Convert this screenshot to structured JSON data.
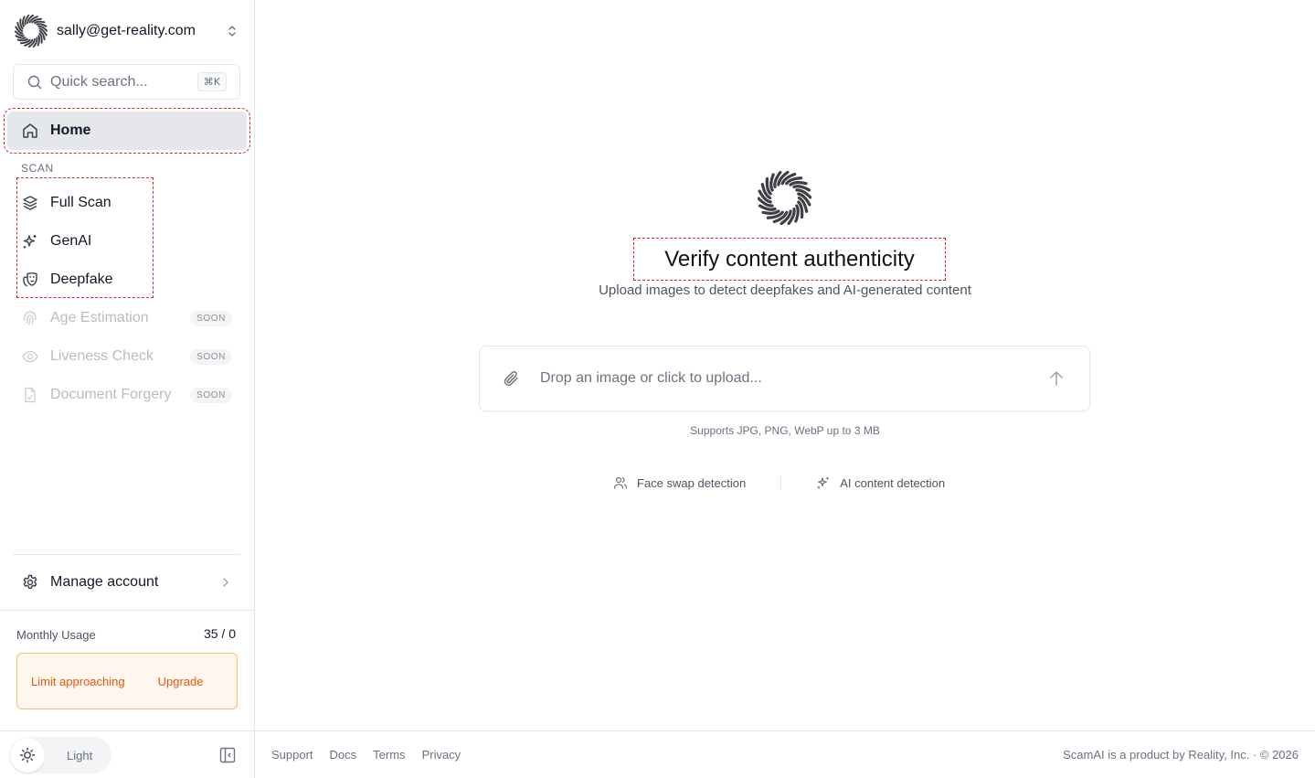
{
  "sidebar": {
    "account_email": "sally@get-reality.com",
    "search": {
      "placeholder": "Quick search...",
      "shortcut": "⌘K"
    },
    "home_label": "Home",
    "section_scan": "SCAN",
    "scan_items": [
      {
        "label": "Full Scan",
        "icon": "layers-icon"
      },
      {
        "label": "GenAI",
        "icon": "sparkles-icon"
      },
      {
        "label": "Deepfake",
        "icon": "theater-mask-icon"
      }
    ],
    "soon_items": [
      {
        "label": "Age Estimation",
        "badge": "SOON",
        "icon": "fingerprint-icon"
      },
      {
        "label": "Liveness Check",
        "badge": "SOON",
        "icon": "eye-icon"
      },
      {
        "label": "Document Forgery",
        "badge": "SOON",
        "icon": "file-icon"
      }
    ],
    "manage_account_label": "Manage account",
    "usage": {
      "label": "Monthly Usage",
      "value": "35 / 0"
    },
    "limit": {
      "message": "Limit approaching",
      "upgrade_label": "Upgrade"
    },
    "theme_label": "Light"
  },
  "main": {
    "title": "Verify content authenticity",
    "subtitle": "Upload images to detect deepfakes and AI-generated content",
    "upload_placeholder": "Drop an image or click to upload...",
    "supports_text": "Supports JPG, PNG, WebP up to 3 MB",
    "features": [
      {
        "label": "Face swap detection",
        "icon": "users-icon"
      },
      {
        "label": "AI content detection",
        "icon": "sparkles-icon"
      }
    ]
  },
  "footer": {
    "links": [
      "Support",
      "Docs",
      "Terms",
      "Privacy"
    ],
    "copyright": "ScamAI is a product by Reality, Inc. · © 2026"
  },
  "colors": {
    "accent_warning": "#ea580c",
    "warning_bg": "#fff7ed",
    "active_bg": "#e5e7eb"
  }
}
